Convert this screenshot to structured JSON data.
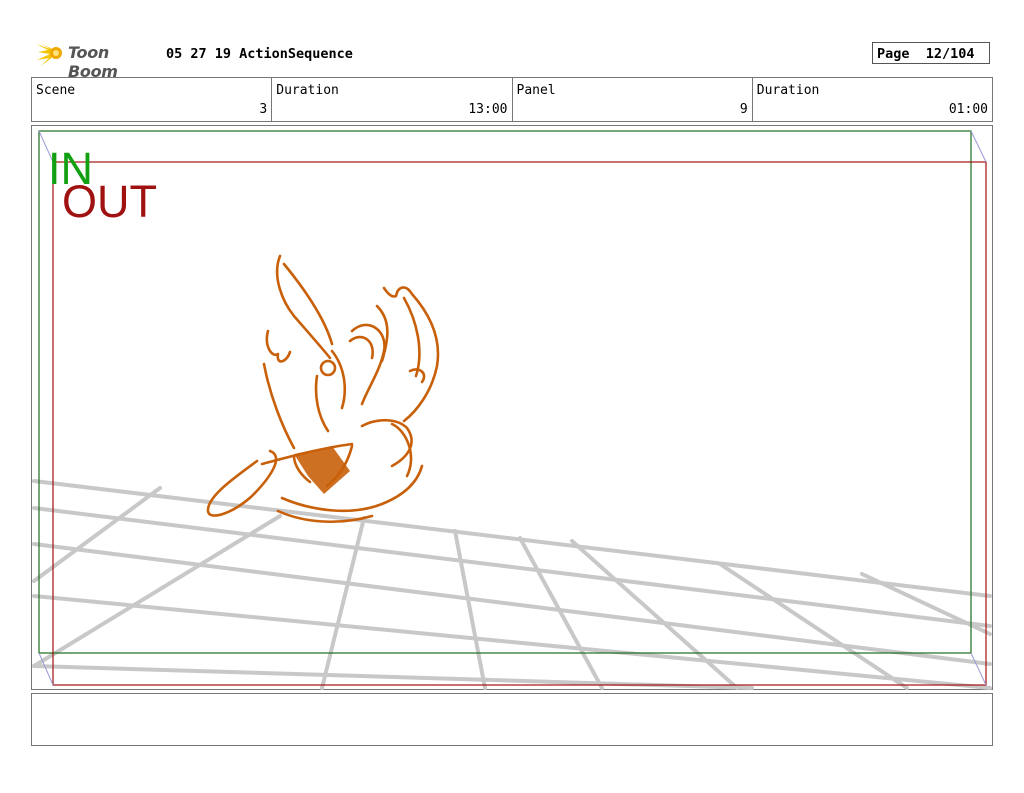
{
  "header": {
    "logo_text": "Toon Boom",
    "title": "05 27 19 ActionSequence",
    "page_label": "Page",
    "page_value": "12/104"
  },
  "info": {
    "scene_label": "Scene",
    "scene_value": "3",
    "scene_duration_label": "Duration",
    "scene_duration_value": "13:00",
    "panel_label": "Panel",
    "panel_value": "9",
    "panel_duration_label": "Duration",
    "panel_duration_value": "01:00"
  },
  "frame": {
    "in_label": "IN",
    "out_label": "OUT",
    "in_color": "#12a012",
    "out_color": "#a01212",
    "sketch_color": "#c8600a",
    "grid_color": "#c8c8c8"
  },
  "notes": {
    "text": ""
  }
}
